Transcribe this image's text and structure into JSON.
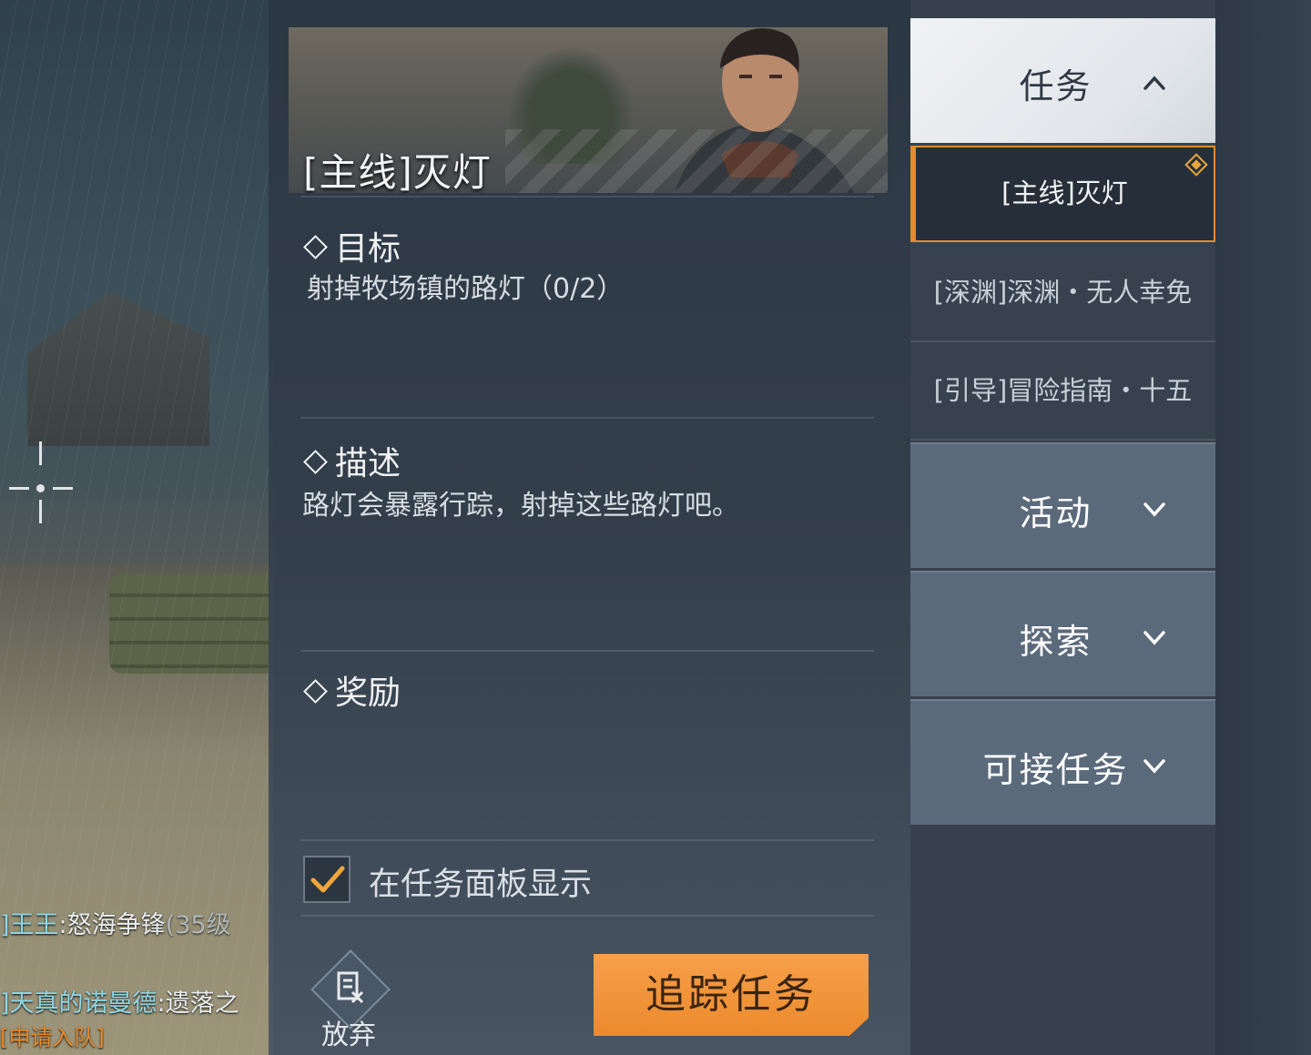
{
  "chat": [
    {
      "channel": "]王王",
      "text": ":怒海争锋",
      "extra": "(35级"
    },
    {
      "channel": "]天真的诺曼德",
      "text": ":遗落之",
      "extra": ""
    },
    {
      "channel": "",
      "text": "",
      "extra": "[申请入队]"
    }
  ],
  "quest_detail": {
    "title": "[主线]灭灯",
    "objective_heading": "目标",
    "objective_text": "射掉牧场镇的路灯（0/2）",
    "description_heading": "描述",
    "description_text": "路灯会暴露行踪，射掉这些路灯吧。",
    "reward_heading": "奖励",
    "show_in_panel_label": "在任务面板显示",
    "show_in_panel_checked": true,
    "abandon_label": "放弃",
    "track_button_label": "追踪任务"
  },
  "sidebar": {
    "categories": [
      {
        "label": "任务",
        "expanded": true
      },
      {
        "label": "活动",
        "expanded": false
      },
      {
        "label": "探索",
        "expanded": false
      },
      {
        "label": "可接任务",
        "expanded": false
      }
    ],
    "quests": [
      {
        "label": "[主线]灭灯",
        "selected": true
      },
      {
        "label": "[深渊]深渊・无人幸免",
        "selected": false
      },
      {
        "label": "[引导]冒险指南・十五",
        "selected": false
      }
    ]
  },
  "colors": {
    "accent_orange": "#e8892c",
    "panel_bg": "#343f4c",
    "tab_active_bg": "#eef0f3",
    "tab_bg": "#5b6a7b"
  },
  "icons": [
    "crosshair-icon",
    "diamond-bullet-icon",
    "checkmark-icon",
    "abandon-document-icon",
    "chevron-up-icon",
    "chevron-down-icon",
    "quest-marker-icon"
  ]
}
